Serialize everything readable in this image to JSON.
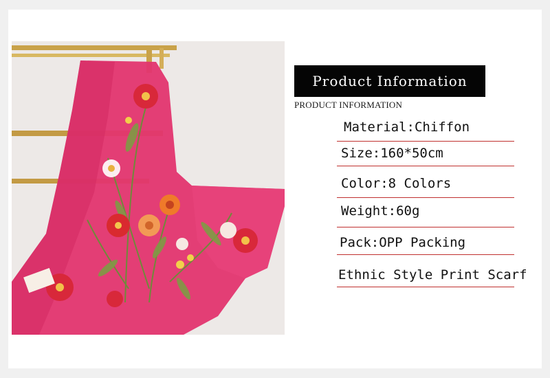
{
  "banner": {
    "title": "Product Information"
  },
  "subtitle": "PRODUCT INFORMATION",
  "specs": [
    {
      "label": "Material:Chiffon"
    },
    {
      "label": "Size:160*50cm"
    },
    {
      "label": "Color:8 Colors"
    },
    {
      "label": "Weight:60g"
    },
    {
      "label": "Pack:OPP Packing"
    },
    {
      "label": "Ethnic Style Print Scarf"
    }
  ],
  "colors": {
    "scarf": "#e3356f",
    "rule": "#c0302f",
    "banner_bg": "#050505",
    "rail": "#c9a24a"
  }
}
